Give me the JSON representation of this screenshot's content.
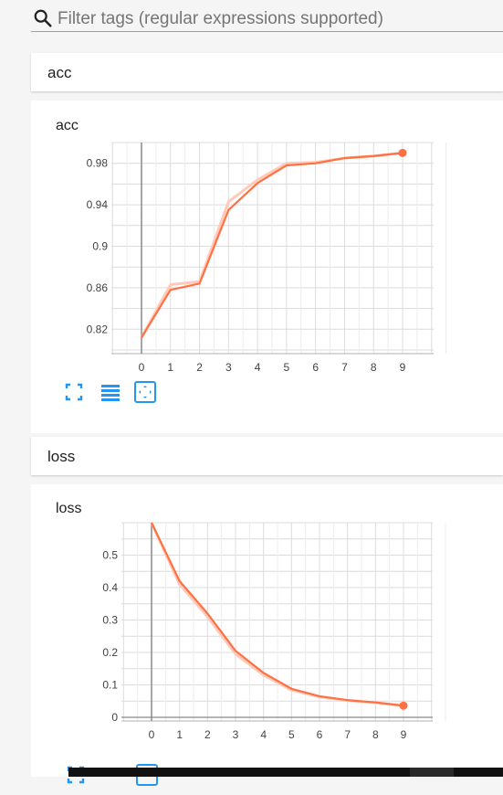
{
  "search": {
    "placeholder": "Filter tags (regular expressions supported)"
  },
  "sections": [
    {
      "header": "acc",
      "card_title": "acc"
    },
    {
      "header": "loss",
      "card_title": "loss"
    }
  ],
  "colors": {
    "line": "#ff7043",
    "smooth_shadow": "#ffcab9",
    "icon_blue": "#2196f3"
  },
  "icons": [
    "search-icon",
    "fit-domain-icon",
    "toggle-log-icon",
    "expand-chart-icon"
  ],
  "chart_data": [
    {
      "type": "line",
      "title": "acc",
      "x": [
        0,
        1,
        2,
        3,
        4,
        5,
        6,
        7,
        8,
        9
      ],
      "series": [
        {
          "values": [
            0.812,
            0.858,
            0.864,
            0.935,
            0.961,
            0.978,
            0.98,
            0.985,
            0.987,
            0.99
          ]
        }
      ],
      "raw_series": [
        0.812,
        0.863,
        0.866,
        0.943,
        0.964,
        0.98,
        0.981,
        0.985,
        0.987,
        0.99
      ],
      "xticks": [
        "0",
        "1",
        "2",
        "3",
        "4",
        "5",
        "6",
        "7",
        "8",
        "9"
      ],
      "yticks": [
        "0.82",
        "0.86",
        "0.9",
        "0.94",
        "0.98"
      ],
      "xlim": [
        0,
        9
      ],
      "ylim": [
        0.8,
        1.0
      ],
      "grid": true
    },
    {
      "type": "line",
      "title": "loss",
      "x": [
        0,
        1,
        2,
        3,
        4,
        5,
        6,
        7,
        8,
        9
      ],
      "series": [
        {
          "values": [
            0.6,
            0.42,
            0.32,
            0.205,
            0.137,
            0.088,
            0.065,
            0.053,
            0.046,
            0.036
          ]
        }
      ],
      "raw_series": [
        0.6,
        0.41,
        0.31,
        0.195,
        0.13,
        0.084,
        0.063,
        0.052,
        0.045,
        0.036
      ],
      "xticks": [
        "0",
        "1",
        "2",
        "3",
        "4",
        "5",
        "6",
        "7",
        "8",
        "9"
      ],
      "yticks": [
        "0",
        "0.1",
        "0.2",
        "0.3",
        "0.4",
        "0.5"
      ],
      "xlim": [
        0,
        9
      ],
      "ylim": [
        0,
        0.6
      ],
      "grid": true
    }
  ]
}
